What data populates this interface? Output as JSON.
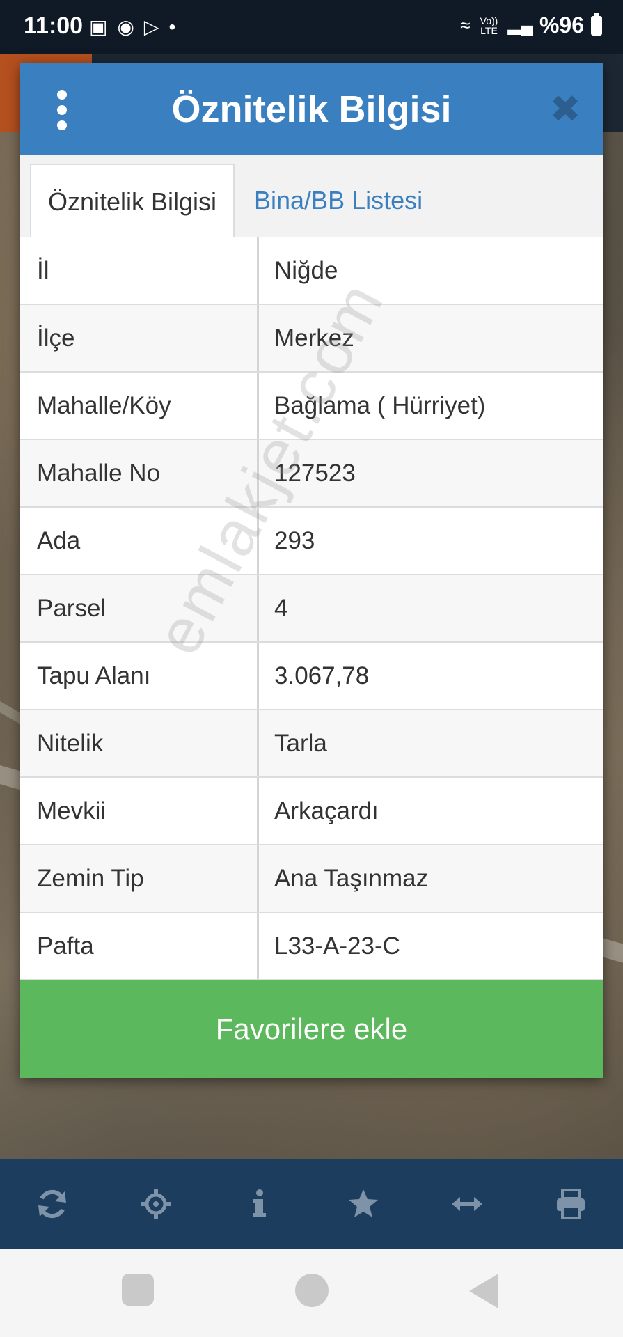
{
  "status_bar": {
    "time": "11:00",
    "battery": "%96",
    "network": "Vo)) LTE",
    "icons": [
      "gallery-icon",
      "messenger-icon",
      "play-store-icon",
      "dot-icon",
      "wifi-icon",
      "signal-icon",
      "battery-icon"
    ]
  },
  "modal": {
    "title": "Öznitelik Bilgisi",
    "tabs": [
      {
        "label": "Öznitelik Bilgisi",
        "active": true
      },
      {
        "label": "Bina/BB Listesi",
        "active": false
      }
    ],
    "rows": [
      {
        "key": "İl",
        "value": "Niğde"
      },
      {
        "key": "İlçe",
        "value": "Merkez"
      },
      {
        "key": "Mahalle/Köy",
        "value": "Bağlama ( Hürriyet)"
      },
      {
        "key": "Mahalle No",
        "value": "127523"
      },
      {
        "key": "Ada",
        "value": "293"
      },
      {
        "key": "Parsel",
        "value": "4"
      },
      {
        "key": "Tapu Alanı",
        "value": "3.067,78"
      },
      {
        "key": "Nitelik",
        "value": "Tarla"
      },
      {
        "key": "Mevkii",
        "value": "Arkaçardı"
      },
      {
        "key": "Zemin Tip",
        "value": "Ana Taşınmaz"
      },
      {
        "key": "Pafta",
        "value": "L33-A-23-C"
      }
    ],
    "favorite_button": "Favorilere ekle"
  },
  "watermark": "emlakjet.com",
  "toolbar_icons": [
    "refresh-icon",
    "crosshair-icon",
    "info-icon",
    "star-icon",
    "measure-icon",
    "print-icon"
  ],
  "colors": {
    "header": "#3a7fbf",
    "favorite": "#5cb85c",
    "toolbar": "#1c3d5e",
    "close": "#2c5f8f"
  }
}
